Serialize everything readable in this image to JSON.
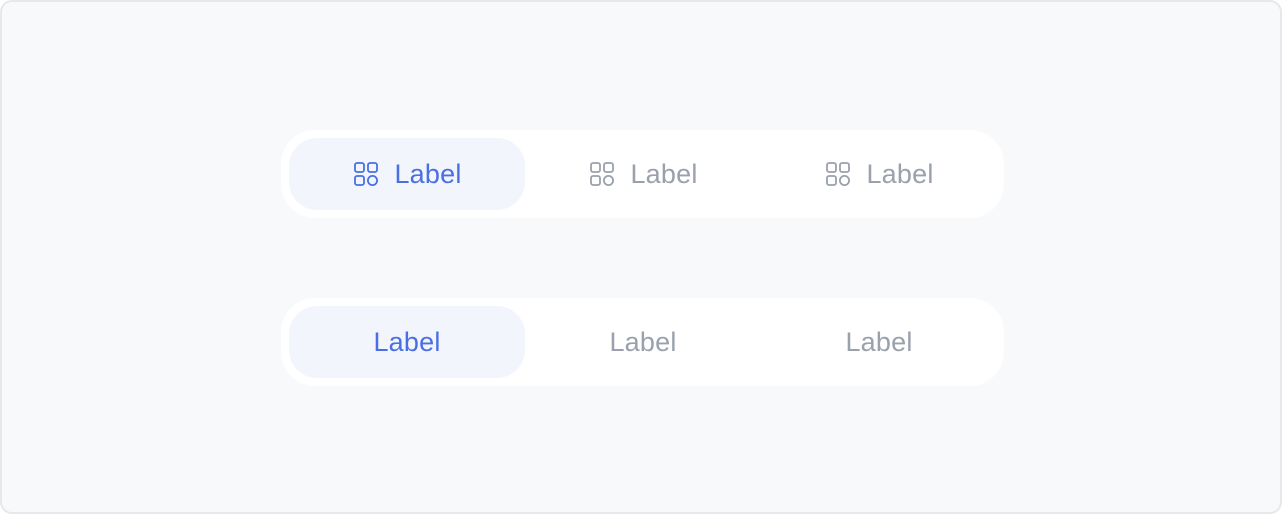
{
  "colors": {
    "background": "#f8f9fb",
    "container": "#ffffff",
    "active_bg": "#f2f5fc",
    "active_text": "#4a6fe3",
    "inactive_text": "#9aa0ac"
  },
  "icon_tabs": {
    "items": [
      {
        "label": "Label",
        "icon": "apps-grid-icon",
        "active": true
      },
      {
        "label": "Label",
        "icon": "apps-grid-icon",
        "active": false
      },
      {
        "label": "Label",
        "icon": "apps-grid-icon",
        "active": false
      }
    ]
  },
  "text_tabs": {
    "items": [
      {
        "label": "Label",
        "active": true
      },
      {
        "label": "Label",
        "active": false
      },
      {
        "label": "Label",
        "active": false
      }
    ]
  }
}
